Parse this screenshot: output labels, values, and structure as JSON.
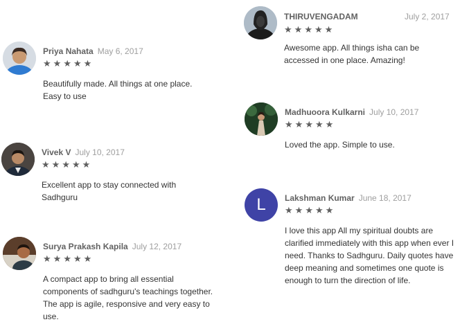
{
  "reviews": [
    {
      "name": "Priya Nahata",
      "date": "May 6, 2017",
      "stars": [
        "★",
        "★",
        "★",
        "★",
        "★"
      ],
      "text": "Beautifully made. All things at one place. Easy to use"
    },
    {
      "name": "Vivek V",
      "date": "July 10, 2017",
      "stars": [
        "★",
        "★",
        "★",
        "★",
        "★"
      ],
      "text": "Excellent app to stay connected with Sadhguru"
    },
    {
      "name": "Surya Prakash Kapila",
      "date": "July 12, 2017",
      "stars": [
        "★",
        "★",
        "★",
        "★",
        "★"
      ],
      "text": "A compact app to bring all essential components of sadhguru's teachings together. The app is agile, responsive and very easy to use."
    },
    {
      "name": "THIRUVENGADAM",
      "date": "July 2, 2017",
      "stars": [
        "★",
        "★",
        "★",
        "★",
        "★"
      ],
      "text": "Awesome app. All things isha can be accessed in one place. Amazing!"
    },
    {
      "name": "Madhuoora Kulkarni",
      "date": "July 10, 2017",
      "stars": [
        "★",
        "★",
        "★",
        "★",
        "★"
      ],
      "text": "Loved the app. Simple to use."
    },
    {
      "name": "Lakshman Kumar",
      "date": "June 18, 2017",
      "avatar_letter": "L",
      "avatar_color": "#3f43a6",
      "stars": [
        "★",
        "★",
        "★",
        "★",
        "★"
      ],
      "text": "I love this app All my spiritual doubts are clarified immediately with this app when ever I need. Thanks to Sadhguru. Daily quotes have deep meaning and sometimes one quote is enough to turn the direction of life."
    }
  ]
}
